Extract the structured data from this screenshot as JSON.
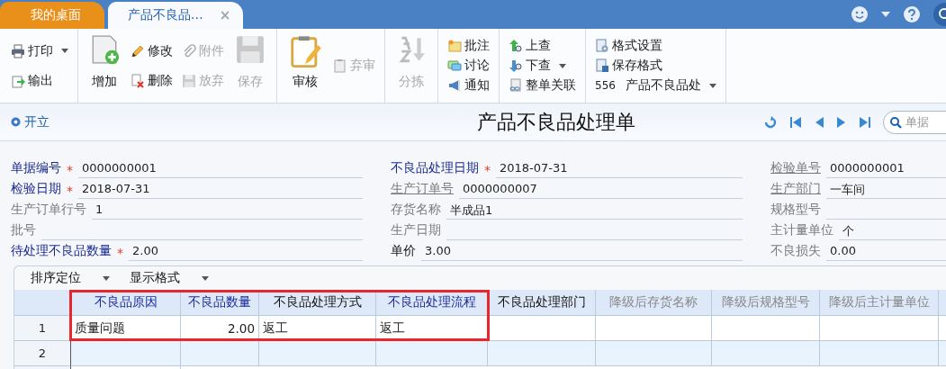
{
  "tabs": [
    {
      "label": "我的桌面",
      "selected": false
    },
    {
      "label": "产品不良品…",
      "selected": true,
      "close": "×"
    }
  ],
  "toolbar": {
    "groups": [
      {
        "columns": [
          [
            {
              "kind": "small",
              "label": "打印",
              "disabled": false,
              "caret": true
            },
            {
              "kind": "small",
              "label": "输出",
              "disabled": false,
              "caret": false
            }
          ]
        ]
      },
      {
        "columns": [
          [
            {
              "kind": "large",
              "label": "增加",
              "disabled": false,
              "caret": false
            }
          ],
          [
            {
              "kind": "small",
              "label": "修改",
              "disabled": false,
              "caret": false
            },
            {
              "kind": "small",
              "label": "删除",
              "disabled": false,
              "caret": false
            }
          ],
          [
            {
              "kind": "small",
              "label": "附件",
              "disabled": true,
              "caret": false
            },
            {
              "kind": "small",
              "label": "放弃",
              "disabled": true,
              "caret": false
            }
          ],
          [
            {
              "kind": "large",
              "label": "保存",
              "disabled": true,
              "caret": false
            }
          ]
        ]
      },
      {
        "columns": [
          [
            {
              "kind": "large",
              "label": "审核",
              "disabled": false,
              "caret": false
            }
          ],
          [
            {
              "kind": "small",
              "label": "弃审",
              "disabled": true,
              "caret": false
            }
          ]
        ]
      },
      {
        "columns": [
          [
            {
              "kind": "large",
              "label": "分拣",
              "disabled": true,
              "caret": false
            }
          ]
        ]
      },
      {
        "columns": [
          [
            {
              "kind": "small",
              "label": "批注",
              "disabled": false,
              "caret": false
            },
            {
              "kind": "small",
              "label": "讨论",
              "disabled": false,
              "caret": false
            },
            {
              "kind": "small",
              "label": "通知",
              "disabled": false,
              "caret": false
            }
          ]
        ]
      },
      {
        "columns": [
          [
            {
              "kind": "small",
              "label": "上查",
              "disabled": false,
              "caret": false
            },
            {
              "kind": "small",
              "label": "下查",
              "disabled": false,
              "caret": true
            },
            {
              "kind": "small",
              "label": "整单关联",
              "disabled": false,
              "caret": false
            }
          ]
        ]
      },
      {
        "columns": [
          [
            {
              "kind": "small",
              "label": "格式设置",
              "disabled": false,
              "caret": false
            },
            {
              "kind": "small",
              "label": "保存格式",
              "disabled": false,
              "caret": false
            },
            {
              "kind": "select",
              "code": "556",
              "label": "产品不良品处",
              "disabled": false,
              "caret": true
            }
          ]
        ]
      }
    ]
  },
  "status": "开立",
  "title": "产品不良品处理单",
  "search": {
    "placeholder": "单据"
  },
  "form": {
    "columns": [
      [
        {
          "label": "单据编号",
          "kind": "required",
          "mark": "*",
          "value": "0000000001"
        },
        {
          "label": "检验日期",
          "kind": "required",
          "mark": "*",
          "value": "2018-07-31"
        },
        {
          "label": "生产订单行号",
          "kind": "plain",
          "value": "1"
        },
        {
          "label": "批号",
          "kind": "plain"
        },
        {
          "label": "待处理不良品数量",
          "kind": "required",
          "mark": "*",
          "value": "2.00"
        }
      ],
      [
        {
          "label": "不良品处理日期",
          "kind": "required",
          "mark": "*",
          "value": "2018-07-31"
        },
        {
          "label": "生产订单号",
          "kind": "link",
          "value": "0000000007"
        },
        {
          "label": "存货名称",
          "kind": "plain",
          "value": "半成品1"
        },
        {
          "label": "生产日期",
          "kind": "plain"
        },
        {
          "label": "单价",
          "kind": "emphasis",
          "value": "3.00"
        }
      ],
      [
        {
          "label": "检验单号",
          "kind": "link",
          "value": "0000000001"
        },
        {
          "label": "生产部门",
          "kind": "link",
          "value": "一车间"
        },
        {
          "label": "规格型号",
          "kind": "plain"
        },
        {
          "label": "主计量单位",
          "kind": "plain",
          "value": "个"
        },
        {
          "label": "不良损失",
          "kind": "plain",
          "value": "0.00"
        }
      ]
    ]
  },
  "grid": {
    "menus": [
      "排序定位",
      "显示格式"
    ],
    "columns": [
      {
        "label": "不良品原因",
        "kind": "required",
        "highlighted": true
      },
      {
        "label": "不良品数量",
        "kind": "required",
        "highlighted": true
      },
      {
        "label": "不良品处理方式",
        "kind": "plain",
        "highlighted": true
      },
      {
        "label": "不良品处理流程",
        "kind": "required",
        "highlighted": true
      },
      {
        "label": "不良品处理部门",
        "kind": "plain",
        "highlighted": false
      },
      {
        "label": "降级后存货名称",
        "kind": "disabled",
        "highlighted": false
      },
      {
        "label": "降级后规格型号",
        "kind": "disabled",
        "highlighted": false
      },
      {
        "label": "降级后主计量单位",
        "kind": "disabled",
        "highlighted": false
      }
    ],
    "rows": [
      {
        "number": "1",
        "cells": [
          {
            "text": "质量问题",
            "kind": "text"
          },
          {
            "text": "2.00",
            "kind": "number"
          },
          {
            "text": "返工",
            "kind": "text"
          },
          {
            "text": "返工",
            "kind": "text"
          }
        ]
      },
      {
        "number": "2"
      }
    ]
  }
}
